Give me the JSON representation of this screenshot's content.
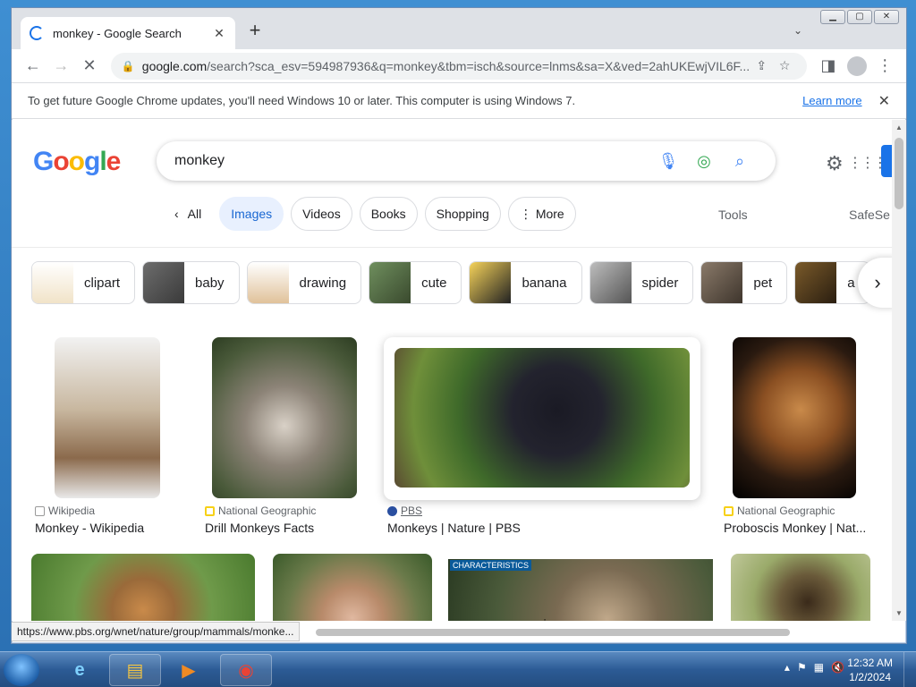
{
  "browser": {
    "tab_title": "monkey - Google Search",
    "newtab_label": "+",
    "url_host": "google.com",
    "url_path": "/search?sca_esv=594987936&q=monkey&tbm=isch&source=lnms&sa=X&ved=2ahUKEwjVIL6F...",
    "infobar_message": "To get future Google Chrome updates, you'll need Windows 10 or later. This computer is using Windows 7.",
    "infobar_link": "Learn more",
    "status_url": "https://www.pbs.org/wnet/nature/group/mammals/monke..."
  },
  "search": {
    "query": "monkey"
  },
  "nav": {
    "all": "All",
    "images": "Images",
    "videos": "Videos",
    "books": "Books",
    "shopping": "Shopping",
    "more": "More",
    "tools": "Tools",
    "safesearch": "SafeSe"
  },
  "related": [
    {
      "label": "clipart"
    },
    {
      "label": "baby"
    },
    {
      "label": "drawing"
    },
    {
      "label": "cute"
    },
    {
      "label": "banana"
    },
    {
      "label": "spider"
    },
    {
      "label": "pet"
    },
    {
      "label": "a"
    }
  ],
  "results": [
    {
      "source": "Wikipedia",
      "title": "Monkey - Wikipedia"
    },
    {
      "source": "National Geographic",
      "title": "Drill Monkeys Facts"
    },
    {
      "source": "PBS",
      "title": "Monkeys | Nature | PBS"
    },
    {
      "source": "National Geographic",
      "title": "Proboscis Monkey | Nat..."
    }
  ],
  "row2": {
    "overlay_label": "CHARACTERISTICS"
  },
  "taskbar": {
    "time": "12:32 AM",
    "date": "1/2/2024"
  },
  "colors": {
    "accent": "#1a73e8",
    "chip_active_bg": "#e8f0fe"
  }
}
